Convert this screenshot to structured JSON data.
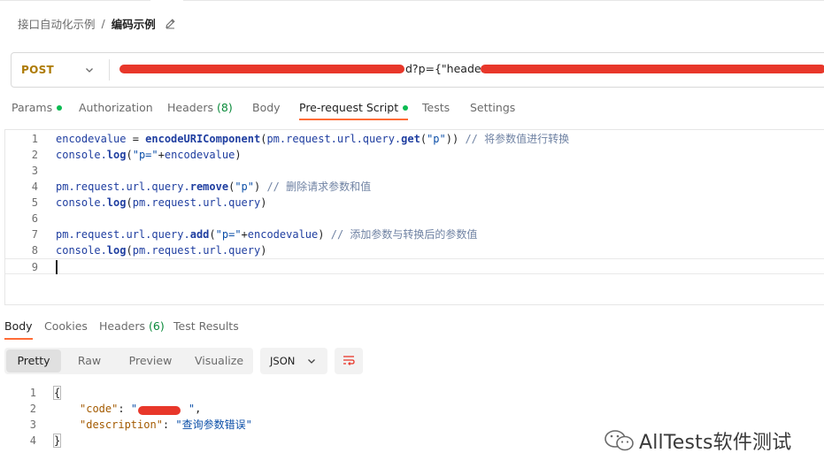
{
  "breadcrumb": {
    "parent": "接口自动化示例",
    "separator": "/",
    "current": "编码示例"
  },
  "request": {
    "method": "POST",
    "url_visible": "d?p={\"header\"",
    "url_note_redacted": true
  },
  "request_tabs": [
    {
      "label": "Params",
      "count": "",
      "dot": true,
      "active": false
    },
    {
      "label": "Authorization",
      "count": "",
      "dot": false,
      "active": false
    },
    {
      "label": "Headers ",
      "count": "(8)",
      "dot": false,
      "active": false
    },
    {
      "label": "Body",
      "count": "",
      "dot": false,
      "active": false
    },
    {
      "label": "Pre-request Script",
      "count": "",
      "dot": true,
      "active": true
    },
    {
      "label": "Tests",
      "count": "",
      "dot": false,
      "active": false
    },
    {
      "label": "Settings",
      "count": "",
      "dot": false,
      "active": false
    }
  ],
  "script_lines": [
    {
      "num": "1",
      "tokens": [
        [
          "id",
          "encodevalue "
        ],
        [
          "op",
          "= "
        ],
        [
          "fn",
          "encodeURIComponent"
        ],
        [
          "op",
          "("
        ],
        [
          "id",
          "pm.request.url.query."
        ],
        [
          "fn",
          "get"
        ],
        [
          "op",
          "("
        ],
        [
          "str",
          "\"p\""
        ],
        [
          "op",
          "))"
        ],
        [
          "cm",
          " // 将参数值进行转换"
        ]
      ]
    },
    {
      "num": "2",
      "tokens": [
        [
          "id",
          "console."
        ],
        [
          "fn",
          "log"
        ],
        [
          "op",
          "("
        ],
        [
          "str",
          "\"p=\""
        ],
        [
          "op",
          "+"
        ],
        [
          "id",
          "encodevalue"
        ],
        [
          "op",
          ")"
        ]
      ]
    },
    {
      "num": "3",
      "tokens": []
    },
    {
      "num": "4",
      "tokens": [
        [
          "id",
          "pm.request.url.query."
        ],
        [
          "fn",
          "remove"
        ],
        [
          "op",
          "("
        ],
        [
          "str",
          "\"p\""
        ],
        [
          "op",
          ")"
        ],
        [
          "cm",
          " // 删除请求参数和值"
        ]
      ]
    },
    {
      "num": "5",
      "tokens": [
        [
          "id",
          "console."
        ],
        [
          "fn",
          "log"
        ],
        [
          "op",
          "("
        ],
        [
          "id",
          "pm.request.url.query"
        ],
        [
          "op",
          ")"
        ]
      ]
    },
    {
      "num": "6",
      "tokens": []
    },
    {
      "num": "7",
      "tokens": [
        [
          "id",
          "pm.request.url.query."
        ],
        [
          "fn",
          "add"
        ],
        [
          "op",
          "("
        ],
        [
          "str",
          "\"p=\""
        ],
        [
          "op",
          "+"
        ],
        [
          "id",
          "encodevalue"
        ],
        [
          "op",
          ")"
        ],
        [
          "cm",
          " // 添加参数与转换后的参数值"
        ]
      ]
    },
    {
      "num": "8",
      "tokens": [
        [
          "id",
          "console."
        ],
        [
          "fn",
          "log"
        ],
        [
          "op",
          "("
        ],
        [
          "id",
          "pm.request.url.query"
        ],
        [
          "op",
          ")"
        ]
      ]
    },
    {
      "num": "9",
      "tokens": []
    }
  ],
  "response_tabs": [
    {
      "label": "Body",
      "count": "",
      "active": true
    },
    {
      "label": "Cookies",
      "count": "",
      "active": false
    },
    {
      "label": "Headers ",
      "count": "(6)",
      "active": false
    },
    {
      "label": "Test Results",
      "count": "",
      "active": false
    }
  ],
  "view_modes": [
    {
      "label": "Pretty",
      "active": true
    },
    {
      "label": "Raw",
      "active": false
    },
    {
      "label": "Preview",
      "active": false
    },
    {
      "label": "Visualize",
      "active": false
    }
  ],
  "format": "JSON",
  "response_lines": [
    {
      "num": "1",
      "text": "{"
    },
    {
      "num": "2",
      "key": "\"code\"",
      "sep": ": ",
      "value": "\"        \"",
      "tail": ",",
      "redacted": true
    },
    {
      "num": "3",
      "key": "\"description\"",
      "sep": ": ",
      "value": "\"查询参数错误\"",
      "tail": ""
    },
    {
      "num": "4",
      "text": "}"
    }
  ],
  "watermark": "AllTests软件测试",
  "colors": {
    "accent": "#ff6c37",
    "method": "#ad7a03",
    "dot": "#0cbb52",
    "redaction": "#e8372a"
  }
}
